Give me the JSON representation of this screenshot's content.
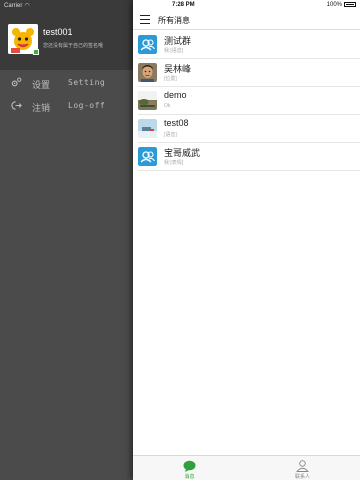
{
  "status_bar": {
    "carrier": "Carrier",
    "time": "7:28 PM",
    "battery": "100%"
  },
  "drawer": {
    "username": "test001",
    "signature": "您还没有属于自己的签名哦",
    "menu": [
      {
        "icon": "gear-icon",
        "label": "设置",
        "label_en": "Setting"
      },
      {
        "icon": "logout-icon",
        "label": "注销",
        "label_en": "Log-off"
      }
    ]
  },
  "navbar": {
    "title": "所有消息"
  },
  "conversations": [
    {
      "name": "测试群",
      "preview": "我:[语音]",
      "avatar": "group-avatar"
    },
    {
      "name": "吴林峰",
      "preview": "[位置]",
      "avatar": "person-photo-avatar"
    },
    {
      "name": "demo",
      "preview": "Ok",
      "avatar": "landscape-avatar"
    },
    {
      "name": "test08",
      "preview": "[语音]",
      "avatar": "sky-avatar"
    },
    {
      "name": "宝哥威武",
      "preview": "我:[表情]",
      "avatar": "group-avatar"
    }
  ],
  "tabbar": {
    "tabs": [
      {
        "label": "消息",
        "icon": "chat-bubble-icon",
        "active": true
      },
      {
        "label": "联系人",
        "icon": "contact-person-icon",
        "active": false
      }
    ]
  },
  "colors": {
    "accent": "#2ea13a",
    "group_avatar": "#2b9bd8",
    "drawer_bg": "#4b4b4b"
  }
}
